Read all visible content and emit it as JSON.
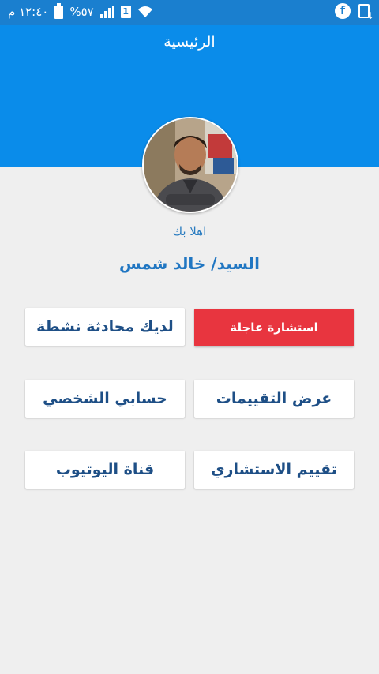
{
  "status_bar": {
    "time": "١٢:٤٠ م",
    "battery": "%٥٧",
    "sim_label": "1"
  },
  "header": {
    "title": "الرئيسية"
  },
  "profile": {
    "greeting": "اهلا بك",
    "name": "السيد/ خالد شمس"
  },
  "buttons": {
    "urgent_consultation": "استشارة عاجلة",
    "active_chat": "لديك محادثة نشطة",
    "view_ratings": "عرض التقييمات",
    "my_account": "حسابي الشخصي",
    "rate_consultant": "تقييم الاستشاري",
    "youtube_channel": "قناة اليوتيوب"
  },
  "colors": {
    "primary": "#0a8cea",
    "urgent": "#e8353f",
    "text_blue": "#1e4f86"
  }
}
